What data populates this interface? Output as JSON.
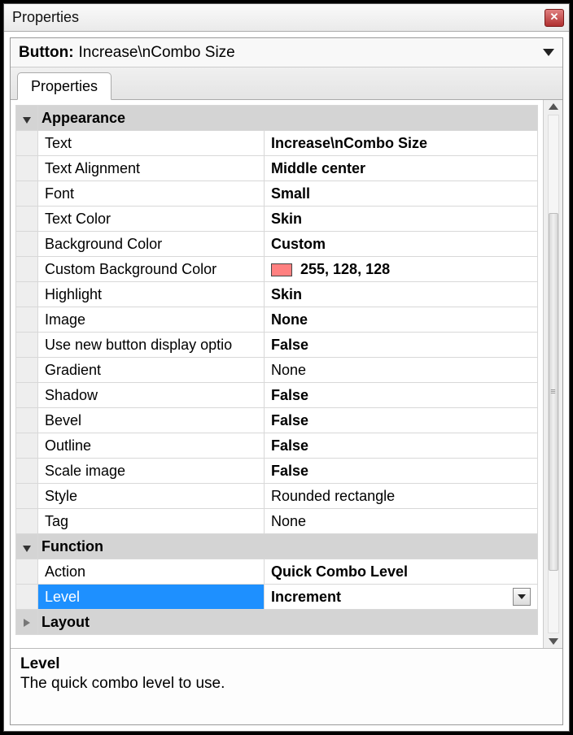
{
  "window": {
    "title": "Properties"
  },
  "header": {
    "label": "Button:",
    "value": "Increase\\nCombo Size"
  },
  "tabs": [
    {
      "label": "Properties"
    }
  ],
  "categories": [
    {
      "name": "Appearance",
      "expanded": true,
      "rows": [
        {
          "name": "Text",
          "value": "Increase\\nCombo Size",
          "bold": true
        },
        {
          "name": "Text Alignment",
          "value": "Middle center",
          "bold": true
        },
        {
          "name": "Font",
          "value": "Small",
          "bold": true
        },
        {
          "name": "Text Color",
          "value": "Skin",
          "bold": true
        },
        {
          "name": "Background Color",
          "value": "Custom",
          "bold": true
        },
        {
          "name": "Custom Background Color",
          "value": "255, 128, 128",
          "bold": true,
          "swatch": "#ff8080"
        },
        {
          "name": "Highlight",
          "value": "Skin",
          "bold": true
        },
        {
          "name": "Image",
          "value": "None",
          "bold": true
        },
        {
          "name": "Use new button display optio",
          "value": "False",
          "bold": true
        },
        {
          "name": "Gradient",
          "value": "None",
          "bold": false
        },
        {
          "name": "Shadow",
          "value": "False",
          "bold": true
        },
        {
          "name": "Bevel",
          "value": "False",
          "bold": true
        },
        {
          "name": "Outline",
          "value": "False",
          "bold": true
        },
        {
          "name": "Scale image",
          "value": "False",
          "bold": true
        },
        {
          "name": "Style",
          "value": "Rounded rectangle",
          "bold": false
        },
        {
          "name": "Tag",
          "value": "None",
          "bold": false
        }
      ]
    },
    {
      "name": "Function",
      "expanded": true,
      "rows": [
        {
          "name": "Action",
          "value": "Quick Combo Level",
          "bold": true
        },
        {
          "name": "Level",
          "value": "Increment",
          "bold": true,
          "selected": true,
          "dropdown": true
        }
      ]
    },
    {
      "name": "Layout",
      "expanded": false,
      "rows": []
    }
  ],
  "description": {
    "title": "Level",
    "text": "The quick combo level to use."
  }
}
